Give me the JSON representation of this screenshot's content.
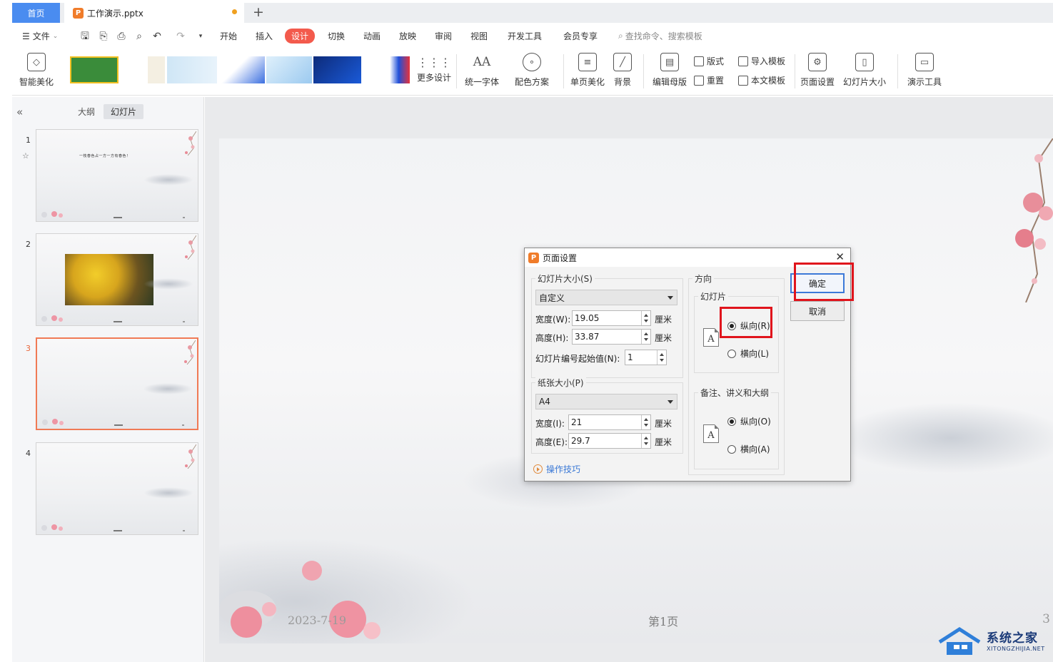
{
  "tabs": {
    "home": "首页",
    "document": "工作演示.pptx",
    "new_tab": "+"
  },
  "menubar": {
    "file": "文件",
    "items": [
      "开始",
      "插入",
      "设计",
      "切换",
      "动画",
      "放映",
      "审阅",
      "视图",
      "开发工具",
      "会员专享"
    ],
    "active_item": "设计",
    "search_placeholder": "查找命令、搜索模板"
  },
  "ribbon": {
    "smart_beautify": "智能美化",
    "more_design": "更多设计",
    "unify_font": "统一字体",
    "color_scheme": "配色方案",
    "single_page_beautify": "单页美化",
    "background": "背景",
    "edit_master": "编辑母版",
    "layout": "版式",
    "reset": "重置",
    "import_template": "导入模板",
    "this_template": "本文模板",
    "page_setup": "页面设置",
    "slide_size": "幻灯片大小",
    "presentation_tools": "演示工具"
  },
  "left_panel": {
    "outline_tab": "大纲",
    "slides_tab": "幻灯片",
    "collapse_icon": "double-chevron-left-icon",
    "slides": [
      {
        "number": "1",
        "title_text": "一枝春色占一方一方有春色！"
      },
      {
        "number": "2",
        "title_text": ""
      },
      {
        "number": "3",
        "title_text": ""
      },
      {
        "number": "4",
        "title_text": ""
      }
    ],
    "current_slide": "3"
  },
  "slide": {
    "date": "2023-7-19",
    "page_label": "第1页",
    "page_number": "3"
  },
  "dialog": {
    "title": "页面设置",
    "slide_size_group": "幻灯片大小(S)",
    "slide_size_value": "自定义",
    "width_label": "宽度(W):",
    "width_value": "19.05",
    "height_label": "高度(H):",
    "height_value": "33.87",
    "unit": "厘米",
    "start_number_label": "幻灯片编号起始值(N):",
    "start_number_value": "1",
    "paper_size_group": "纸张大小(P)",
    "paper_size_value": "A4",
    "paper_width_label": "宽度(I):",
    "paper_width_value": "21",
    "paper_height_label": "高度(E):",
    "paper_height_value": "29.7",
    "orientation_group": "方向",
    "slide_orientation_group": "幻灯片",
    "portrait_r": "纵向(R)",
    "landscape_l": "横向(L)",
    "notes_group": "备注、讲义和大纲",
    "portrait_o": "纵向(O)",
    "landscape_a": "横向(A)",
    "ok": "确定",
    "cancel": "取消",
    "tips": "操作技巧",
    "icon_letter": "A"
  },
  "watermark": {
    "cn": "系统之家",
    "en": "XITONGZHIJIA.NET"
  },
  "colors": {
    "accent_blue": "#4a8cf0",
    "design_tab_red": "#f35a4c",
    "highlight_red": "#e0141c",
    "current_slide_border": "#f07a55"
  }
}
